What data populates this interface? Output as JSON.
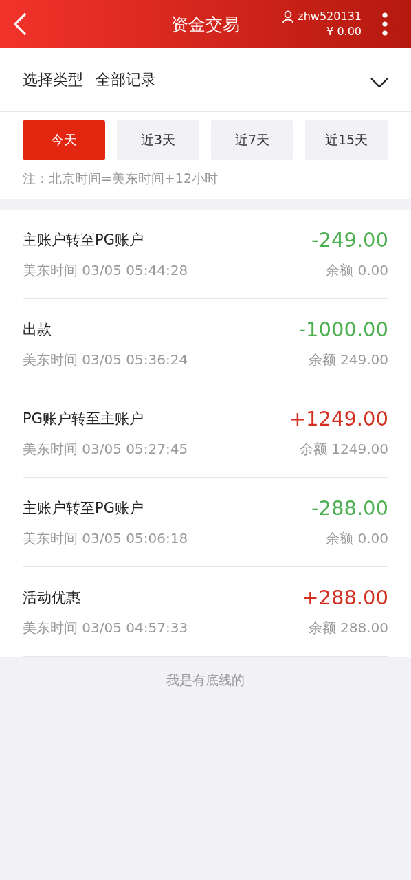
{
  "header": {
    "title": "资金交易",
    "username": "zhw520131",
    "balance": "¥ 0.00"
  },
  "filter": {
    "label": "选择类型",
    "value": "全部记录"
  },
  "ranges": [
    {
      "label": "今天",
      "selected": true
    },
    {
      "label": "近3天",
      "selected": false
    },
    {
      "label": "近7天",
      "selected": false
    },
    {
      "label": "近15天",
      "selected": false
    }
  ],
  "note": "注：北京时间=美东时间+12小时",
  "records": [
    {
      "title": "主账户转至PG账户",
      "time": "美东时间 03/05 05:44:28",
      "amount": "-249.00",
      "kind": "out",
      "balance": "余额 0.00"
    },
    {
      "title": "出款",
      "time": "美东时间 03/05 05:36:24",
      "amount": "-1000.00",
      "kind": "out",
      "balance": "余额 249.00"
    },
    {
      "title": "PG账户转至主账户",
      "time": "美东时间 03/05 05:27:45",
      "amount": "+1249.00",
      "kind": "in",
      "balance": "余额 1249.00"
    },
    {
      "title": "主账户转至PG账户",
      "time": "美东时间 03/05 05:06:18",
      "amount": "-288.00",
      "kind": "out",
      "balance": "余额 0.00"
    },
    {
      "title": "活动优惠",
      "time": "美东时间 03/05 04:57:33",
      "amount": "+288.00",
      "kind": "in",
      "balance": "余额 288.00"
    }
  ],
  "footer": "我是有底线的"
}
